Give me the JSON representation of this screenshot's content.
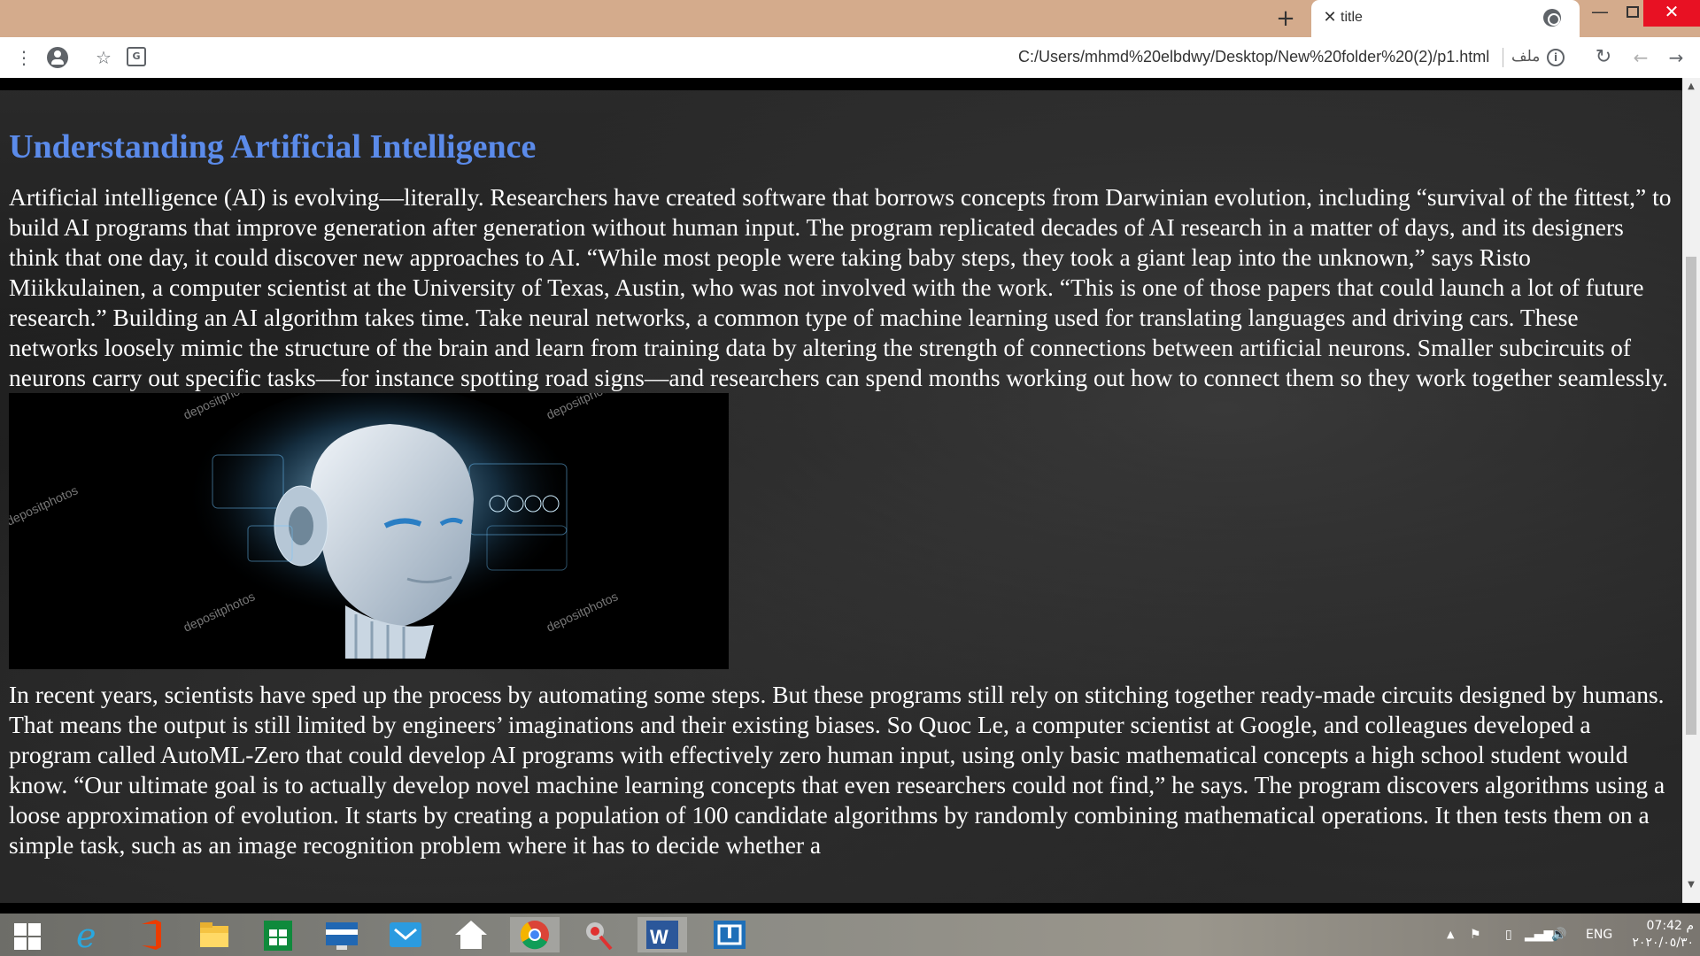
{
  "browser": {
    "tab": {
      "title": "title",
      "close_glyph": "✕",
      "favicon": "globe-icon"
    },
    "new_tab_glyph": "+",
    "window_controls": {
      "minimize": "—",
      "close": "✕"
    },
    "address_bar": {
      "url": "C:/Users/mhmd%20elbdwy/Desktop/New%20folder%20(2)/p1.html",
      "scheme_label": "ملف"
    },
    "icons": [
      "menu-icon",
      "account-icon",
      "star-icon",
      "translate-icon",
      "info-icon",
      "reload-icon",
      "back-icon",
      "forward-icon"
    ]
  },
  "page": {
    "heading": "Understanding Artificial Intelligence",
    "paragraph1": "Artificial intelligence (AI) is evolving—literally. Researchers have created software that borrows concepts from Darwinian evolution, including “survival of the fittest,” to build AI programs that improve generation after generation without human input. The program replicated decades of AI research in a matter of days, and its designers think that one day, it could discover new approaches to AI. “While most people were taking baby steps, they took a giant leap into the unknown,” says Risto Miikkulainen, a computer scientist at the University of Texas, Austin, who was not involved with the work. “This is one of those papers that could launch a lot of future research.” Building an AI algorithm takes time. Take neural networks, a common type of machine learning used for translating languages and driving cars. These networks loosely mimic the structure of the brain and learn from training data by altering the strength of connections between artificial neurons. Smaller subcircuits of neurons carry out specific tasks—for instance spotting road signs—and researchers can spend months working out how to connect them so they work together seamlessly.",
    "image": {
      "subject": "robot-head-illustration",
      "watermark": "depositphotos"
    },
    "paragraph2": "In recent years, scientists have sped up the process by automating some steps. But these programs still rely on stitching together ready-made circuits designed by humans. That means the output is still limited by engineers’ imaginations and their existing biases. So Quoc Le, a computer scientist at Google, and colleagues developed a program called AutoML-Zero that could develop AI programs with effectively zero human input, using only basic mathematical concepts a high school student would know. “Our ultimate goal is to actually develop novel machine learning concepts that even researchers could not find,” he says. The program discovers algorithms using a loose approximation of evolution. It starts by creating a population of 100 candidate algorithms by randomly combining mathematical operations. It then tests them on a simple task, such as an image recognition problem where it has to decide whether a"
  },
  "taskbar": {
    "apps": [
      "start-icon",
      "internet-explorer-icon",
      "office-icon",
      "file-explorer-icon",
      "store-icon",
      "lenovo-icon",
      "mail-icon",
      "home-icon",
      "chrome-icon",
      "tool-icon",
      "word-icon",
      "app-icon"
    ],
    "tray": {
      "language": "ENG",
      "time": "07:42 م",
      "date": "٢٠٢٠/٠٥/٣٠"
    }
  },
  "colors": {
    "tabstrip": "#d4ab8c",
    "heading": "#5b8bea",
    "body_text": "#ffffff",
    "close_button": "#e81123"
  }
}
